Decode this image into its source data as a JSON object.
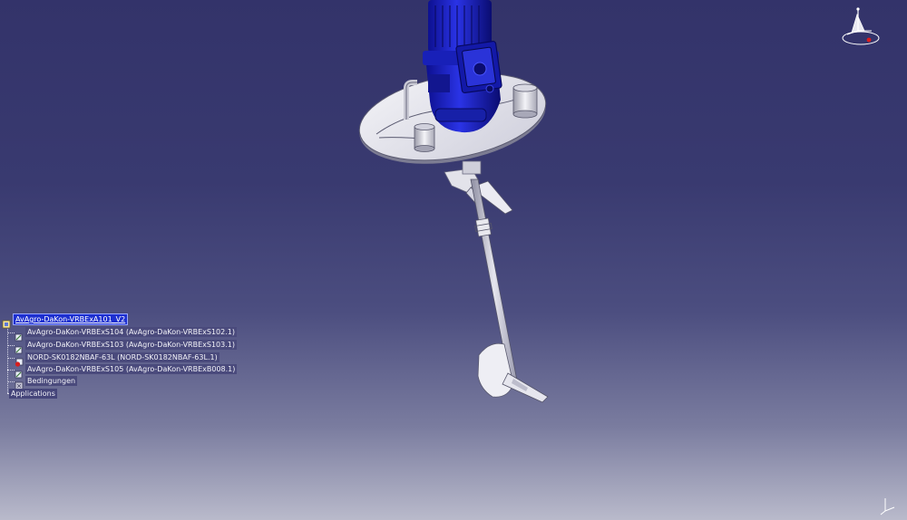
{
  "spec_tree": {
    "root": {
      "label": "AvAgro-DaKon-VRBExA101_V2",
      "icon": "product-icon"
    },
    "items": [
      {
        "label": "AvAgro-DaKon-VRBExS104 (AvAgro-DaKon-VRBExS102.1)",
        "icon": "part-icon"
      },
      {
        "label": "AvAgro-DaKon-VRBExS103 (AvAgro-DaKon-VRBExS103.1)",
        "icon": "part-icon"
      },
      {
        "label": "NORD-SK0182NBAF-63L (NORD-SK0182NBAF-63L.1)",
        "icon": "part-error-icon"
      },
      {
        "label": "AvAgro-DaKon-VRBExS105 (AvAgro-DaKon-VRBExB008.1)",
        "icon": "part-icon"
      },
      {
        "label": "Bedingungen",
        "icon": "constraints-icon"
      },
      {
        "label": "Applications",
        "icon": ""
      }
    ]
  },
  "compass": {
    "icon": "compass-icon",
    "axes": [
      "z",
      "y",
      "x"
    ]
  },
  "mini_axis": {
    "icon": "axis-system-icon",
    "axes": [
      "y",
      "x"
    ]
  },
  "colors": {
    "background_top": "#33336a",
    "background_bottom": "#b9bacb",
    "motor": "#1a1fc8",
    "plate": "#e6e6ee",
    "selection": "#1d2fd0"
  }
}
